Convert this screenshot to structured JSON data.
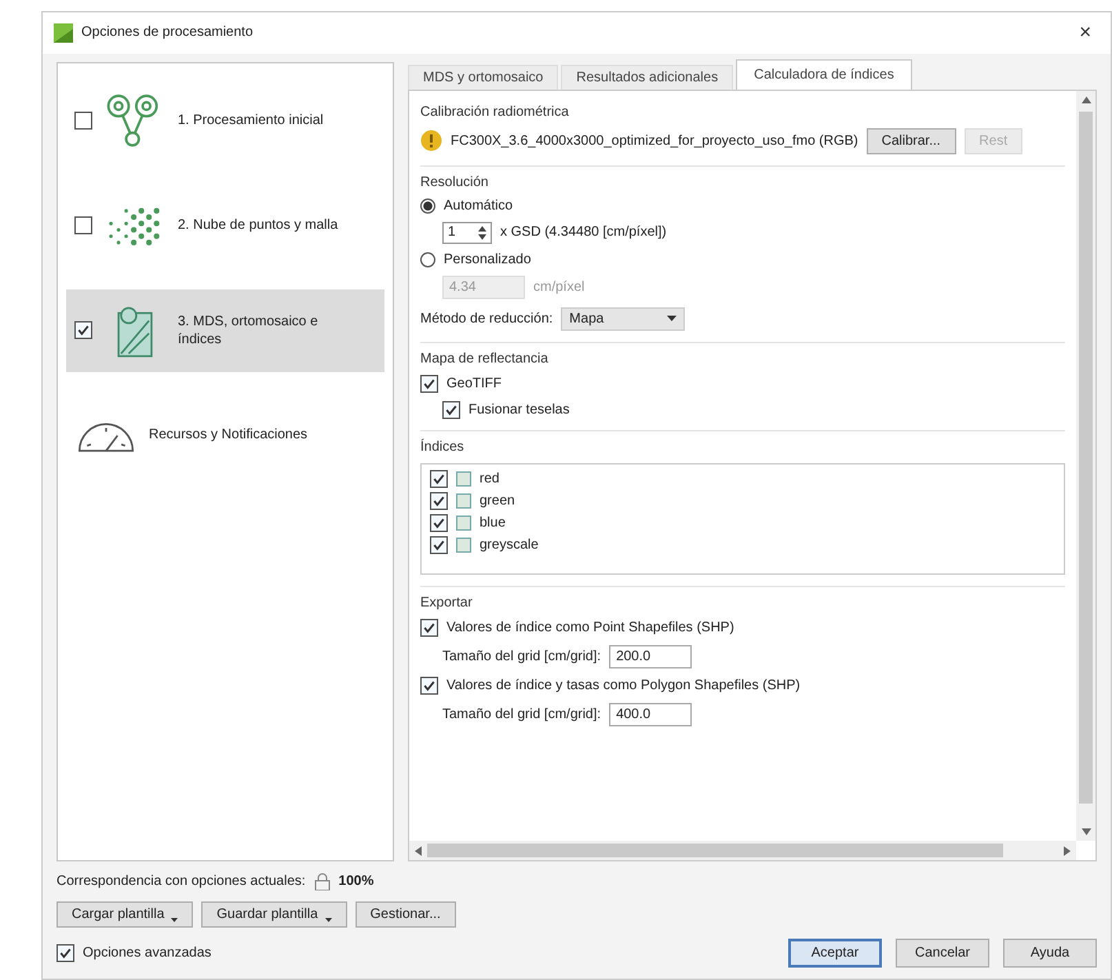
{
  "window": {
    "title": "Opciones de procesamiento",
    "close": "×"
  },
  "steps": [
    {
      "kind": "network",
      "label": "1. Procesamiento inicial",
      "checked": false,
      "selected": false
    },
    {
      "kind": "cloud",
      "label": "2. Nube de puntos y malla",
      "checked": false,
      "selected": false
    },
    {
      "kind": "map",
      "label": "3. MDS, ortomosaico e índices",
      "checked": true,
      "selected": true
    },
    {
      "kind": "gauge",
      "label": "Recursos y Notificaciones",
      "selected": false
    }
  ],
  "tabs": [
    {
      "label": "MDS y ortomosaico",
      "selected": false
    },
    {
      "label": "Resultados adicionales",
      "selected": false
    },
    {
      "label": "Calculadora de índices",
      "selected": true
    }
  ],
  "calibration": {
    "title": "Calibración radiométrica",
    "camera": "FC300X_3.6_4000x3000_optimized_for_proyecto_uso_fmo (RGB)",
    "buttons": [
      {
        "label": "Calibrar...",
        "disabled": false
      },
      {
        "label": "Rest",
        "disabled": true
      }
    ]
  },
  "resolution": {
    "title": "Resolución",
    "automatic": {
      "label": "Automático",
      "selected": true
    },
    "multiplier": "1",
    "gsd": "x GSD (4.34480 [cm/píxel])",
    "custom": {
      "label": "Personalizado",
      "selected": false
    },
    "custom_value": "4.34",
    "custom_unit": "cm/píxel",
    "method_label": "Método de reducción:",
    "method": "Mapa"
  },
  "reflectance": {
    "title": "Mapa de reflectancia",
    "options": [
      {
        "label": "GeoTIFF",
        "checked": true
      },
      {
        "label": "Fusionar teselas",
        "checked": true
      }
    ]
  },
  "indices": {
    "title": "Índices",
    "items": [
      {
        "label": "red",
        "checked": true
      },
      {
        "label": "green",
        "checked": true
      },
      {
        "label": "blue",
        "checked": true
      },
      {
        "label": "greyscale",
        "checked": true
      }
    ]
  },
  "export": {
    "title": "Exportar",
    "options": [
      {
        "label": "Valores de índice como Point Shapefiles (SHP)",
        "checked": true,
        "grid_label": "Tamaño del grid [cm/grid]:",
        "grid_value": "200.0"
      },
      {
        "label": "Valores de índice y tasas como Polygon Shapefiles (SHP)",
        "checked": true,
        "grid_label": "Tamaño del grid [cm/grid]:",
        "grid_value": "400.0"
      }
    ]
  },
  "match": {
    "label": "Correspondencia con opciones actuales:",
    "value": "100%"
  },
  "template_buttons": [
    {
      "label": "Cargar plantilla",
      "menu": true
    },
    {
      "label": "Guardar plantilla",
      "menu": true
    },
    {
      "label": "Gestionar...",
      "menu": false
    }
  ],
  "advanced": {
    "label": "Opciones avanzadas",
    "checked": true
  },
  "dialog_buttons": [
    {
      "label": "Aceptar",
      "default": true
    },
    {
      "label": "Cancelar",
      "default": false
    },
    {
      "label": "Ayuda",
      "default": false
    }
  ]
}
